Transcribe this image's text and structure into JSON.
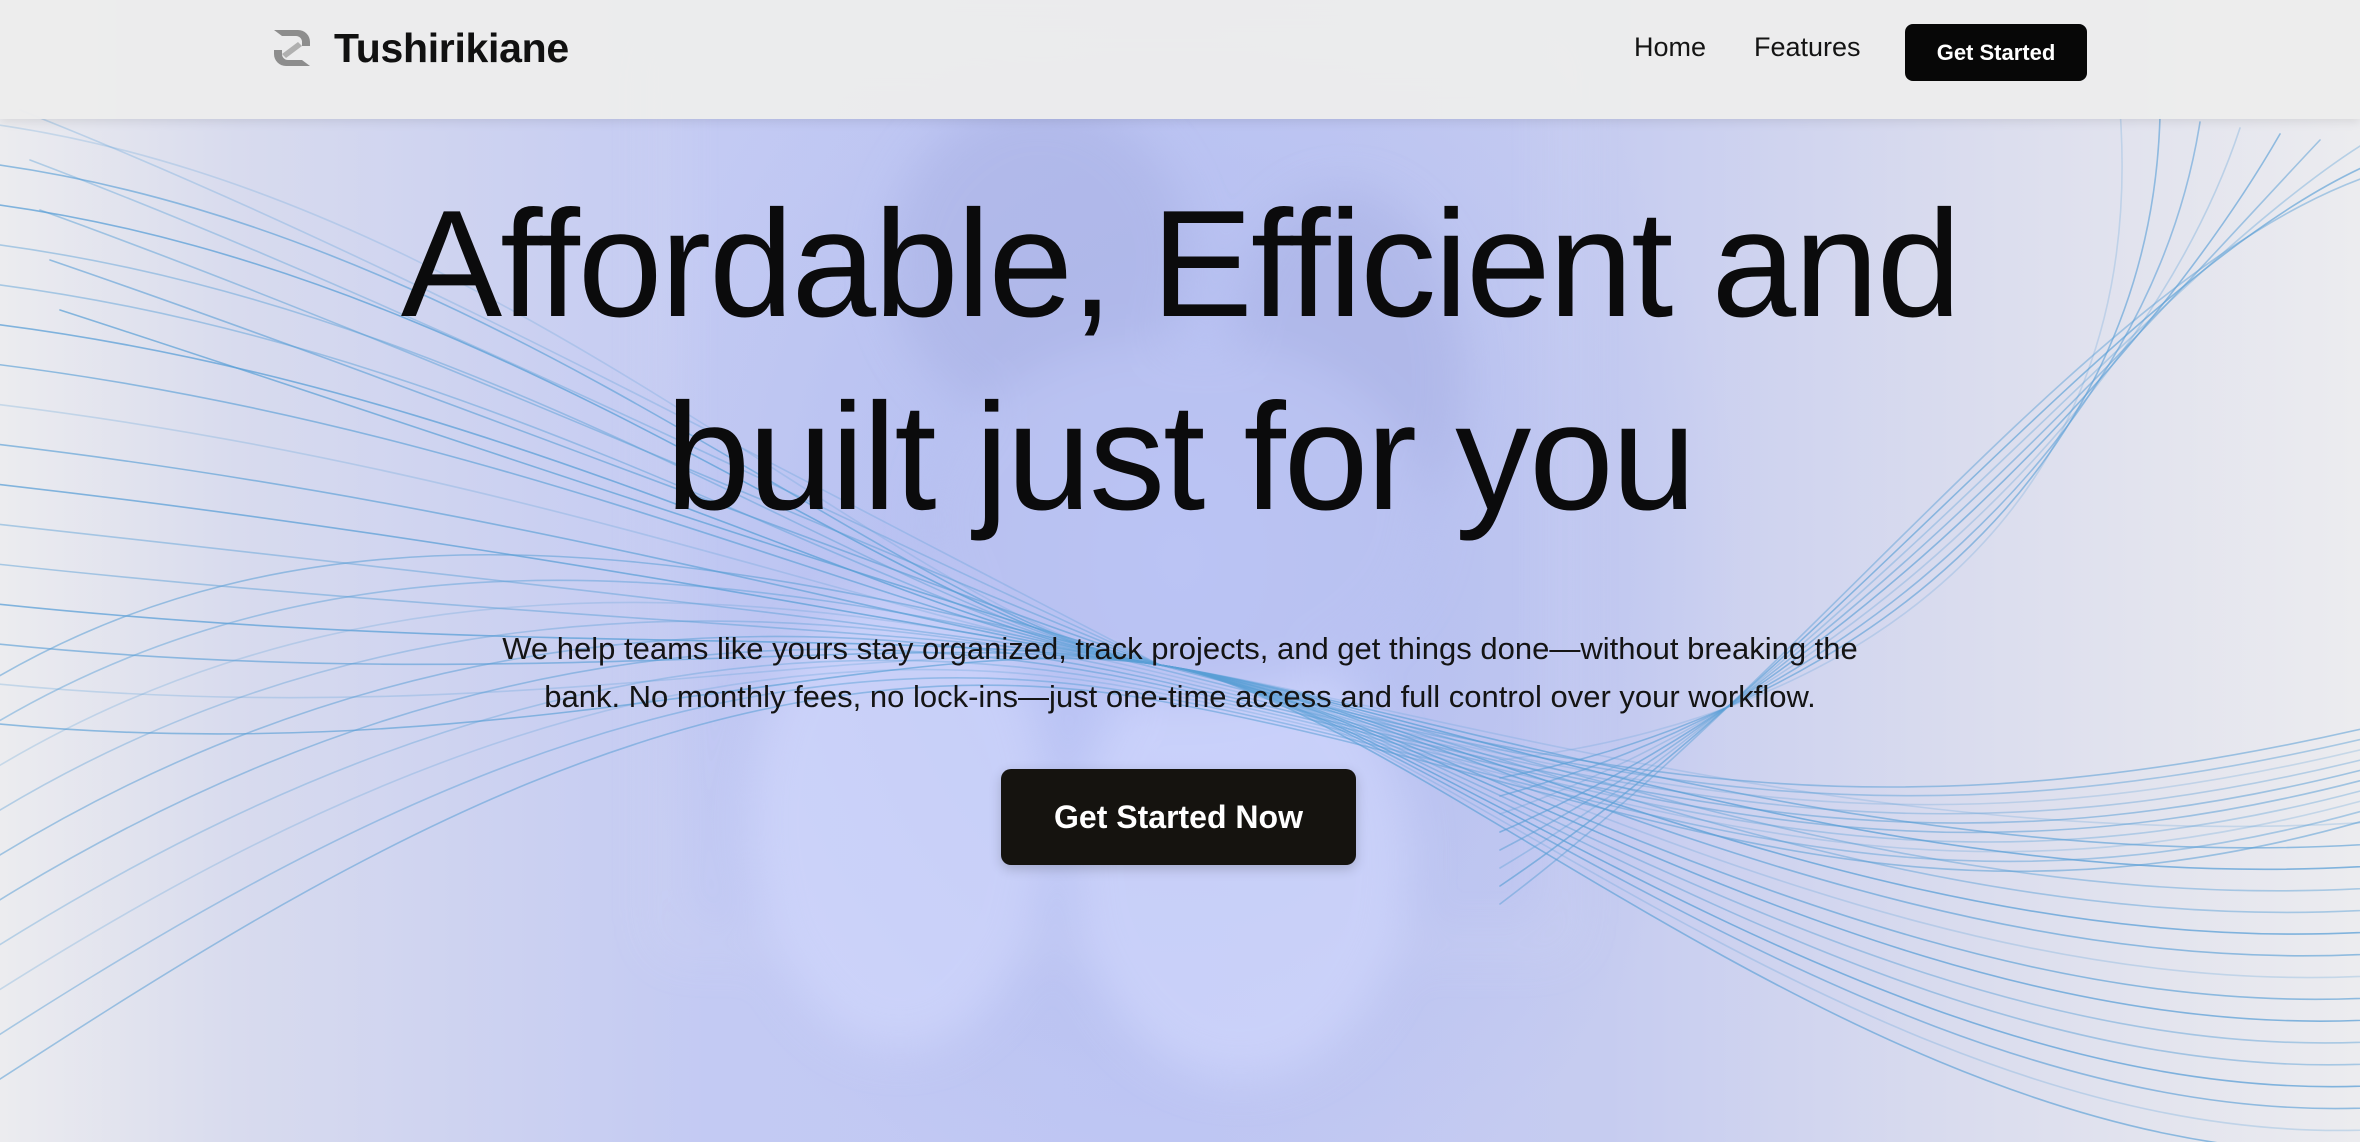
{
  "navbar": {
    "brand_name": "Tushirikiane",
    "logo_icon": "tushirikiane-logo-icon",
    "links": [
      {
        "label": "Home"
      },
      {
        "label": "Features"
      }
    ],
    "cta_label": "Get Started"
  },
  "hero": {
    "headline_line1": "Affordable, Efficient and",
    "headline_line2": "built just for you",
    "subtext_line1": "We help teams like yours stay organized, track projects, and get things done—without breaking the",
    "subtext_line2": "bank. No monthly fees, no lock-ins—just one-time access and full control over your workflow.",
    "cta_label": "Get Started Now"
  },
  "colors": {
    "accent_dark": "#070707",
    "hero_tint": "#c3caf3",
    "line_color": "#5a9fd6"
  }
}
